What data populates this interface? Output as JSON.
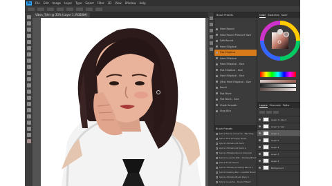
{
  "window": {
    "menu": [
      "File",
      "Edit",
      "Image",
      "Layer",
      "Type",
      "Select",
      "Filter",
      "3D",
      "View",
      "Window",
      "Help"
    ],
    "doc_tab_title": "Vibes_Tyler @ 33% (Layer 1, RGB/8#)"
  },
  "brush_panel": {
    "title": "Brush Presets",
    "selected_index": 4,
    "items": [
      "Hard Round",
      "Hard Round Pressure Size",
      "Soft Round",
      "Hard Elliptical",
      "Flat Elliptical",
      "Hard Elliptical",
      "Hard Elliptical - Size",
      "Flat Elliptical - Size",
      "Hard Elliptical - Size",
      "(Mix) Hard Elliptical - Size",
      "Pencil",
      "Flat Blunt",
      "Flat Blunt - Size",
      "Chalk Smooth",
      "Stop Blur"
    ]
  },
  "actions_panel": {
    "title": "Brush Presets",
    "items": [
      "Kyle's Blocky Gouache - Bad Dog",
      "Kyle's Thai Grungey Brush",
      "Kyle's Ultimate Oil Paint",
      "Kyle's Ultimate Oil Paint 2",
      "Kyle's Ultimate Round Charcoal",
      "Kyle's Gouache Wet - Stumpy Brush",
      "Kyle's Brush Pencil",
      "Kyle's Ultimate Drawing Pencil 2",
      "Kyle's Drawing Pen - Leadhill Brush",
      "Kyle's Ultimate Brush Pack 3",
      "Kyle's Gouache - Round Filbert",
      "Kyle's Gouache - Round 2"
    ]
  },
  "color_panel": {
    "tabs": [
      "Color",
      "Swatches",
      "Kuler"
    ],
    "active_tab": "Color",
    "foreground": "#a38d8a",
    "background": "#e0d8d4"
  },
  "layers_panel": {
    "tabs": [
      "Layers",
      "Channels",
      "Paths"
    ],
    "active_tab": "Layers",
    "active_index": 2,
    "layers": [
      "Layer 1 copy 2",
      "Layer 1 copy",
      "Layer 1",
      "Layer 5",
      "Layer 4",
      "Layer 3",
      "Layer 2",
      "Background"
    ]
  },
  "colors": {
    "accent_selected": "#d87a1a",
    "ps_blue": "#31a8ff"
  }
}
